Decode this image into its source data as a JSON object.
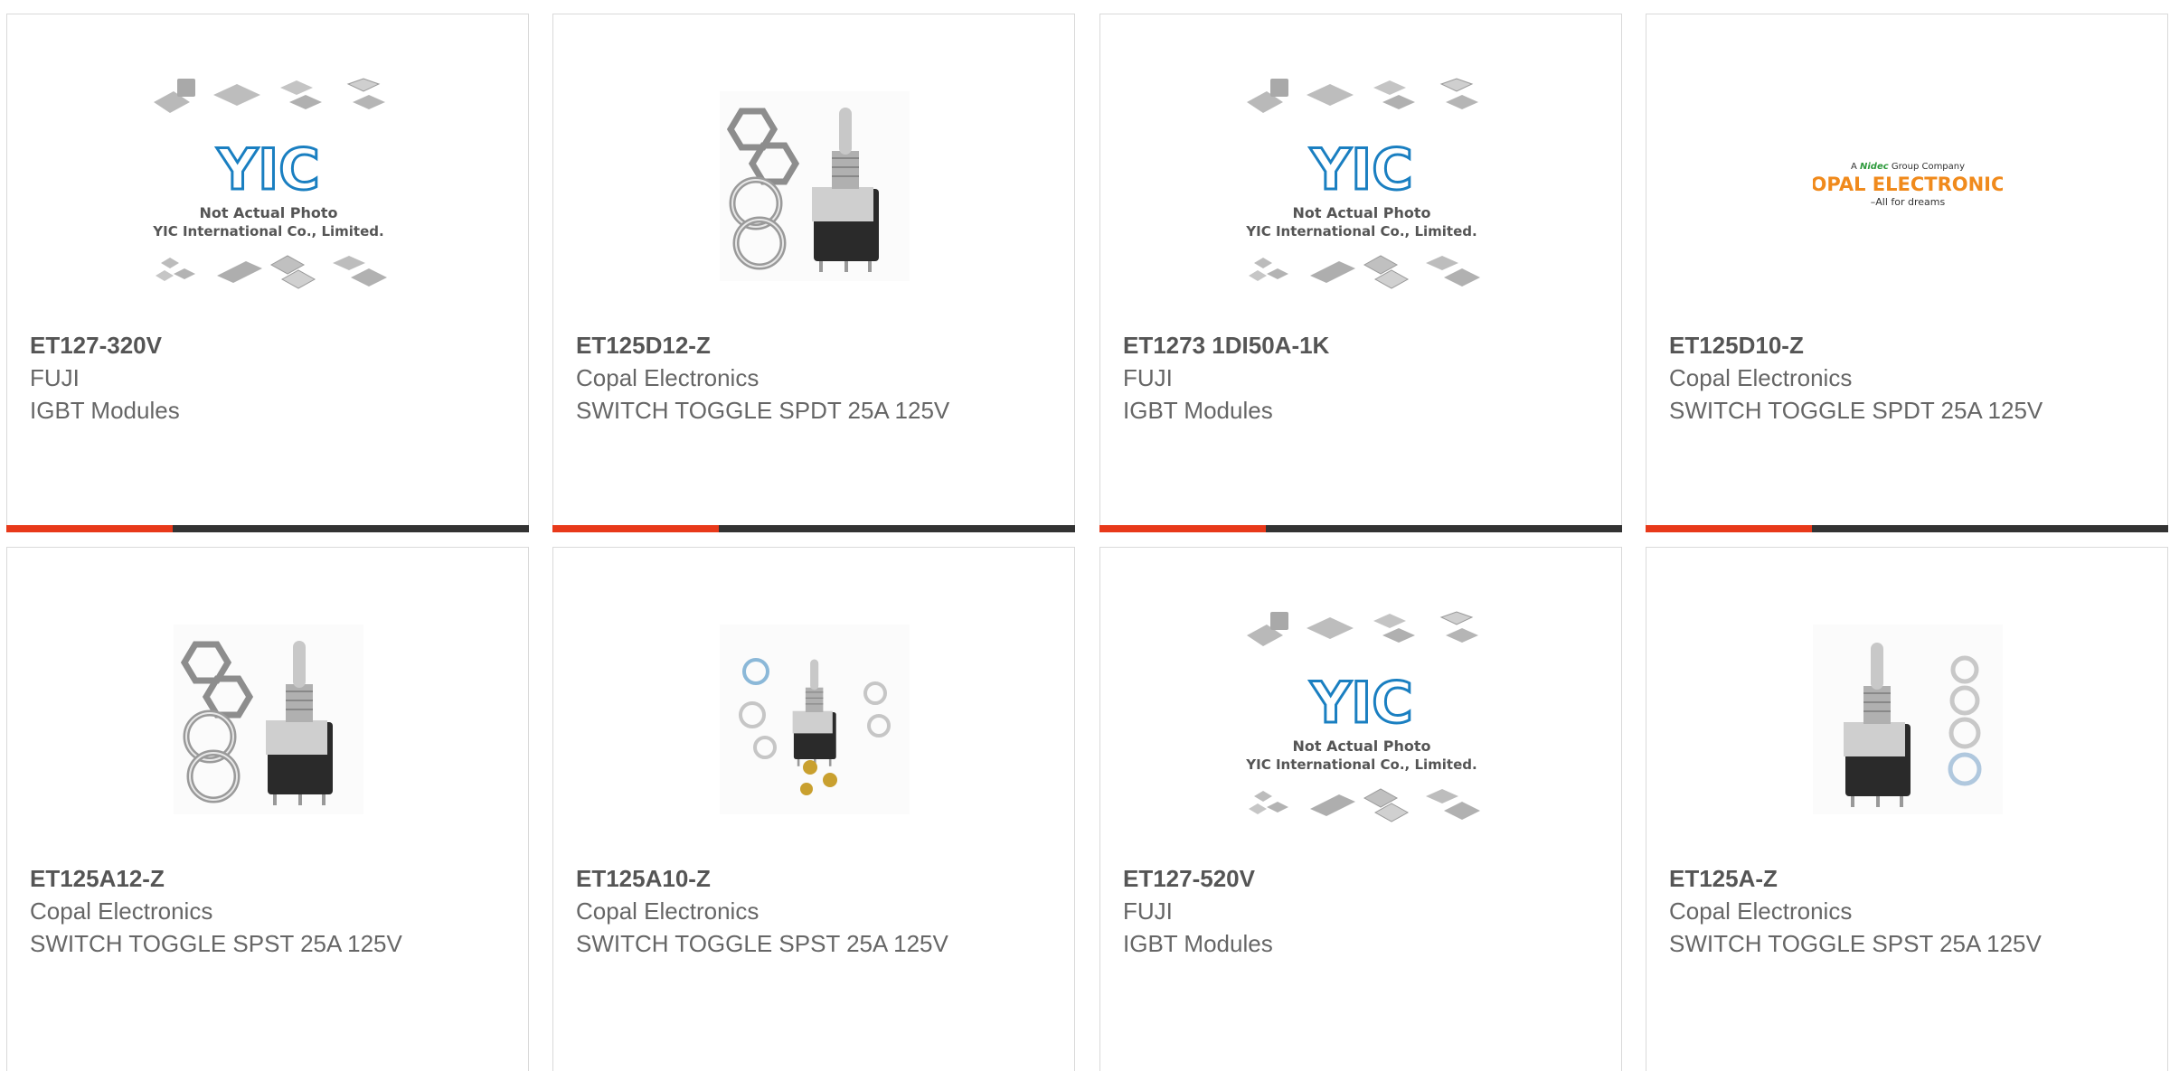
{
  "products": [
    {
      "part": "ET127-320V",
      "manufacturer": "FUJI",
      "description": "IGBT Modules",
      "image": "not-actual-photo"
    },
    {
      "part": "ET125D12-Z",
      "manufacturer": "Copal Electronics",
      "description": "SWITCH TOGGLE SPDT 25A 125V",
      "image": "toggle-switch-large"
    },
    {
      "part": "ET1273 1DI50A-1K",
      "manufacturer": "FUJI",
      "description": "IGBT Modules",
      "image": "not-actual-photo"
    },
    {
      "part": "ET125D10-Z",
      "manufacturer": "Copal Electronics",
      "description": "SWITCH TOGGLE SPDT 25A 125V",
      "image": "copal-logo"
    },
    {
      "part": "ET125A12-Z",
      "manufacturer": "Copal Electronics",
      "description": "SWITCH TOGGLE SPST 25A 125V",
      "image": "toggle-switch-large"
    },
    {
      "part": "ET125A10-Z",
      "manufacturer": "Copal Electronics",
      "description": "SWITCH TOGGLE SPST 25A 125V",
      "image": "toggle-switch-small"
    },
    {
      "part": "ET127-520V",
      "manufacturer": "FUJI",
      "description": "IGBT Modules",
      "image": "not-actual-photo"
    },
    {
      "part": "ET125A-Z",
      "manufacturer": "Copal Electronics",
      "description": "SWITCH TOGGLE SPST 25A 125V",
      "image": "toggle-switch-side"
    }
  ],
  "placeholder_image": {
    "logo_text": "YIC",
    "line1": "Not Actual Photo",
    "line2": "YIC International Co., Limited."
  },
  "copal_logo": {
    "tagline_prefix": "A",
    "brand": "Nidec",
    "tagline_suffix": "Group Company",
    "name": "COPAL ELECTRONICS",
    "slogan": "–All for dreams"
  },
  "colors": {
    "accent": "#e8391a",
    "bar": "#333333",
    "yic_blue": "#1a7fc1",
    "copal_orange": "#f08a1c",
    "nidec_green": "#2e9a3c"
  }
}
